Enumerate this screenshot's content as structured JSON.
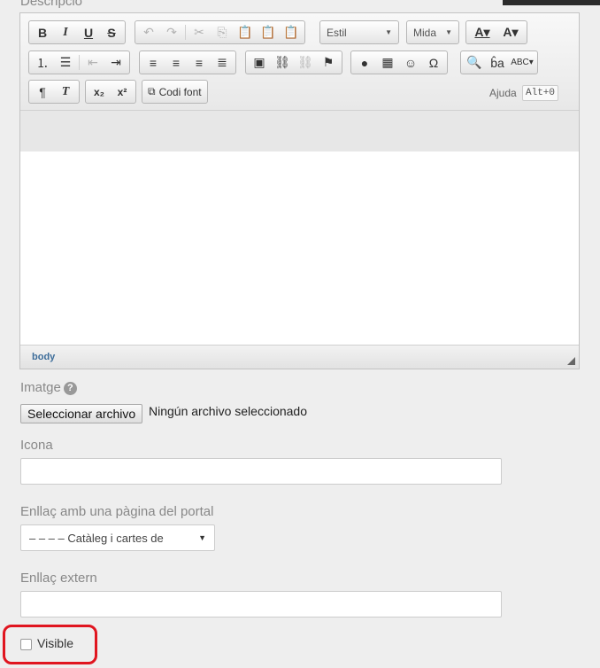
{
  "top_label": "Descripció",
  "editor": {
    "style_combo": "Estil",
    "size_combo": "Mida",
    "source_label": "Codi font",
    "help_label": "Ajuda",
    "help_shortcut": "Alt+0",
    "path": "body"
  },
  "image_field": {
    "label": "Imatge",
    "button_label": "Seleccionar archivo",
    "status": "Ningún archivo seleccionado"
  },
  "icon_field": {
    "label": "Icona",
    "value": ""
  },
  "portal_link": {
    "label": "Enllaç amb una pàgina del portal",
    "selected": "– – – –  Catàleg i cartes de"
  },
  "external_link": {
    "label": "Enllaç extern",
    "value": ""
  },
  "visible": {
    "label": "Visible",
    "checked": false
  },
  "colors": {
    "highlight": "#e0151f",
    "path": "#3d6d9a"
  }
}
